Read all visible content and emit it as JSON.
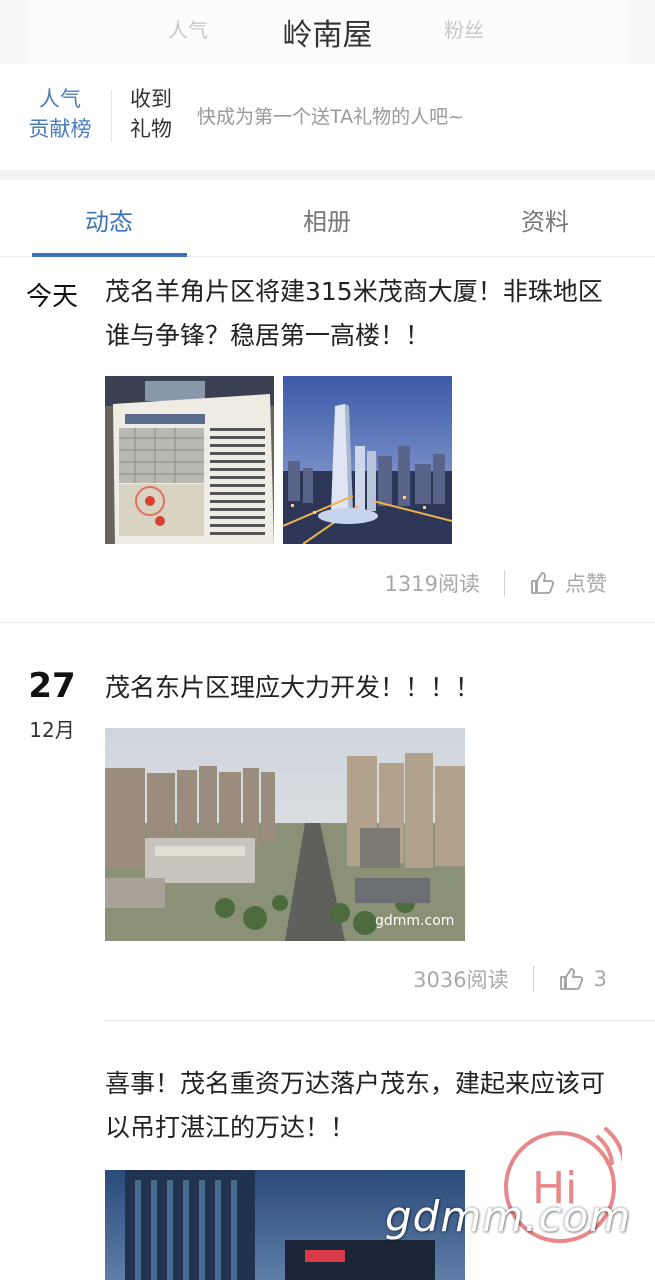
{
  "header": {
    "title": "岭南屋",
    "ghost_left": "人气",
    "ghost_right": "粉丝"
  },
  "gift_bar": {
    "rank_line1": "人气",
    "rank_line2": "贡献榜",
    "received_line1": "收到",
    "received_line2": "礼物",
    "hint": "快成为第一个送TA礼物的人吧~"
  },
  "tabs": [
    {
      "label": "动态",
      "active": true
    },
    {
      "label": "相册",
      "active": false
    },
    {
      "label": "资料",
      "active": false
    }
  ],
  "posts": [
    {
      "date_label": "今天",
      "title": "茂名羊角片区将建315米茂商大厦！非珠地区谁与争锋？稳居第一高楼！！",
      "reads": "1319阅读",
      "like_label": "点赞"
    },
    {
      "date_day": "27",
      "date_month": "12月",
      "title": "茂名东片区理应大力开发！！！！",
      "reads": "3036阅读",
      "like_label": "3",
      "image_watermark": "gdmm.com"
    },
    {
      "title": "喜事！茂名重资万达落户茂东，建起来应该可以吊打湛江的万达！！"
    }
  ],
  "overlay": {
    "hi_text": "Hi",
    "watermark": "gdmm.com"
  },
  "colors": {
    "accent": "#3f73b8",
    "muted": "#a8a8a8",
    "hi": "#e8888a"
  }
}
